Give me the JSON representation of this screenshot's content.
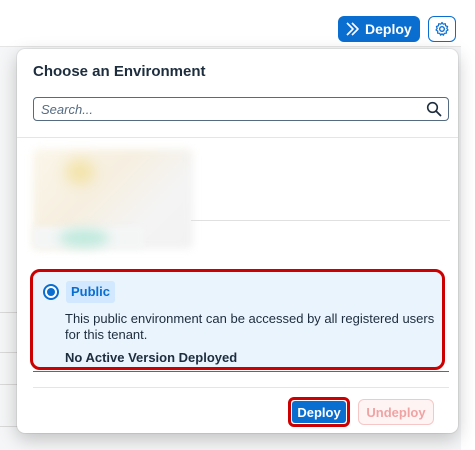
{
  "header": {
    "deploy_label": "Deploy",
    "deploy_icon": "double-arrow-right-icon",
    "settings_icon": "gear-icon"
  },
  "popover": {
    "title": "Choose an Environment",
    "search": {
      "placeholder": "Search...",
      "value": ""
    },
    "environments": [
      {
        "name": "Public",
        "selected": true,
        "description": "This public environment can be accessed by all registered users for this tenant.",
        "status": "No Active Version Deployed"
      }
    ],
    "footer": {
      "deploy_label": "Deploy",
      "undeploy_label": "Undeploy"
    }
  },
  "colors": {
    "accent": "#0a6ed1",
    "highlight_border": "#cc0000",
    "card_background": "#eaf4fd"
  }
}
